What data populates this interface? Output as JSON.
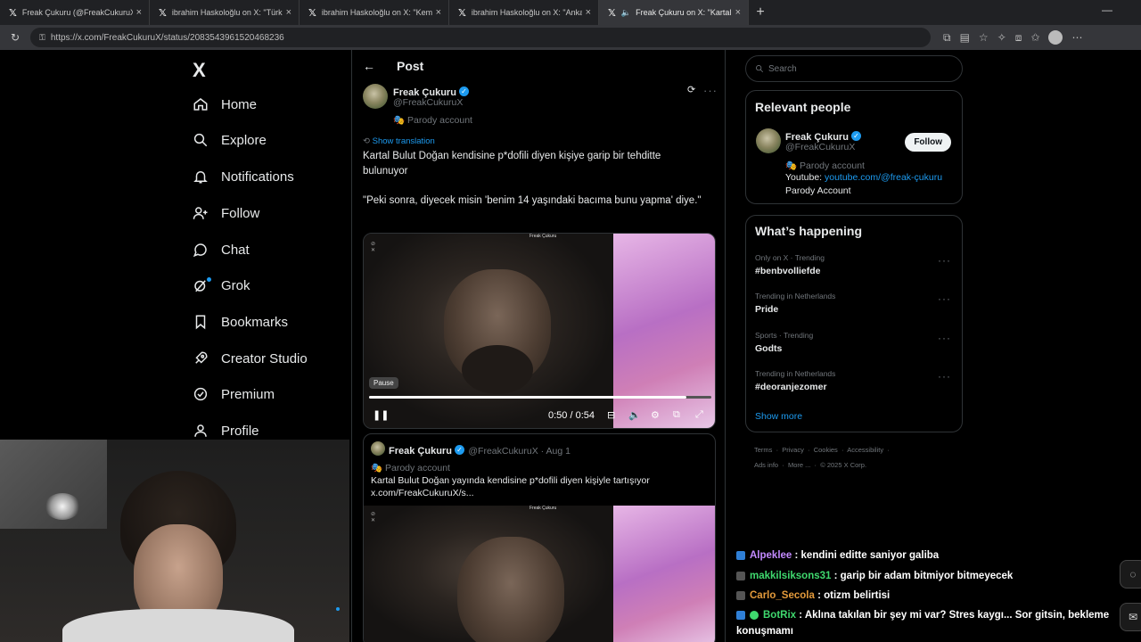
{
  "browser": {
    "tabs": [
      {
        "title": "Freak Çukuru (@FreakCukuruX) / X",
        "active": false
      },
      {
        "title": "ibrahim Haskoloğlu on X: \"Türkiye",
        "active": false
      },
      {
        "title": "ibrahim Haskoloğlu on X: \"Kemal",
        "active": false
      },
      {
        "title": "ibrahim Haskoloğlu on X: \"Ankara",
        "active": false
      },
      {
        "title": "Freak Çukuru on X: \"Kartal Bul",
        "active": true
      }
    ],
    "url": "https://x.com/FreakCukuruX/status/2083543961520468236"
  },
  "sidebar": {
    "logo": "X",
    "items": [
      {
        "label": "Home",
        "icon": "home-icon"
      },
      {
        "label": "Explore",
        "icon": "search-icon"
      },
      {
        "label": "Notifications",
        "icon": "bell-icon"
      },
      {
        "label": "Follow",
        "icon": "person-plus-icon"
      },
      {
        "label": "Chat",
        "icon": "chat-icon"
      },
      {
        "label": "Grok",
        "icon": "grok-icon"
      },
      {
        "label": "Bookmarks",
        "icon": "bookmark-icon"
      },
      {
        "label": "Creator Studio",
        "icon": "rocket-icon"
      },
      {
        "label": "Premium",
        "icon": "premium-icon"
      },
      {
        "label": "Profile",
        "icon": "person-icon"
      }
    ]
  },
  "post": {
    "header_title": "Post",
    "author_name": "Freak Çukuru",
    "author_handle": "@FreakCukuruX",
    "parody_label": "Parody account",
    "show_translation": "Show translation",
    "text_line1": "Kartal Bulut Doğan kendisine p*dofili diyen kişiye garip bir tehditte bulunuyor",
    "text_line2": "\"Peki sonra, diyecek misin 'benim 14 yaşındaki bacıma bunu yapma' diye.\"",
    "video": {
      "watermark": "Freak Çukuru",
      "pause_tooltip": "Pause",
      "time": "0:50 / 0:54",
      "progress": 0.926
    },
    "quote": {
      "author_name": "Freak Çukuru",
      "author_handle": "@FreakCukuruX · Aug 1",
      "parody_label": "Parody account",
      "text": "Kartal Bulut Doğan yayında kendisine p*dofili diyen kişiyle tartışıyor x.com/FreakCukuruX/s..."
    }
  },
  "right": {
    "search_placeholder": "Search",
    "relevant": {
      "title": "Relevant people",
      "name": "Freak Çukuru",
      "handle": "@FreakCukuruX",
      "parody_label": "Parody account",
      "follow_label": "Follow",
      "bio_prefix": "Youtube: ",
      "bio_link": "youtube.com/@freak-çukuru",
      "bio_line2": "Parody Account"
    },
    "happening": {
      "title": "What’s happening",
      "trends": [
        {
          "meta": "Only on X · Trending",
          "name": "#benbvolliefde"
        },
        {
          "meta": "Trending in Netherlands",
          "name": "Pride"
        },
        {
          "meta": "Sports · Trending",
          "name": "Godts"
        },
        {
          "meta": "Trending in Netherlands",
          "name": "#deoranjezomer"
        }
      ],
      "show_more": "Show more"
    },
    "footer": {
      "line1": [
        "Terms",
        "Privacy",
        "Cookies",
        "Accessibility"
      ],
      "line2": [
        "Ads info",
        "More ...",
        "© 2025 X Corp."
      ]
    }
  },
  "chat": [
    {
      "user": "Alpeklee",
      "color": "#c38aff",
      "message": ": kendini editte saniyor galiba"
    },
    {
      "user": "makkilsiksons31",
      "color": "#3fd86e",
      "message": ": garip bir adam bitmiyor bitmeyecek"
    },
    {
      "user": "Carlo_Secola",
      "color": "#e39a3b",
      "message": ": otizm belirtisi"
    },
    {
      "user": "BotRix",
      "color": "#3fd86e",
      "message": ": Aklına takılan bir şey mi var? Stres kaygı... Sor gitsin, bekleme konuşmamı"
    }
  ],
  "colors": {
    "accent": "#1d9bf0",
    "background": "#000000",
    "border": "#2f3336",
    "muted": "#71767b"
  }
}
